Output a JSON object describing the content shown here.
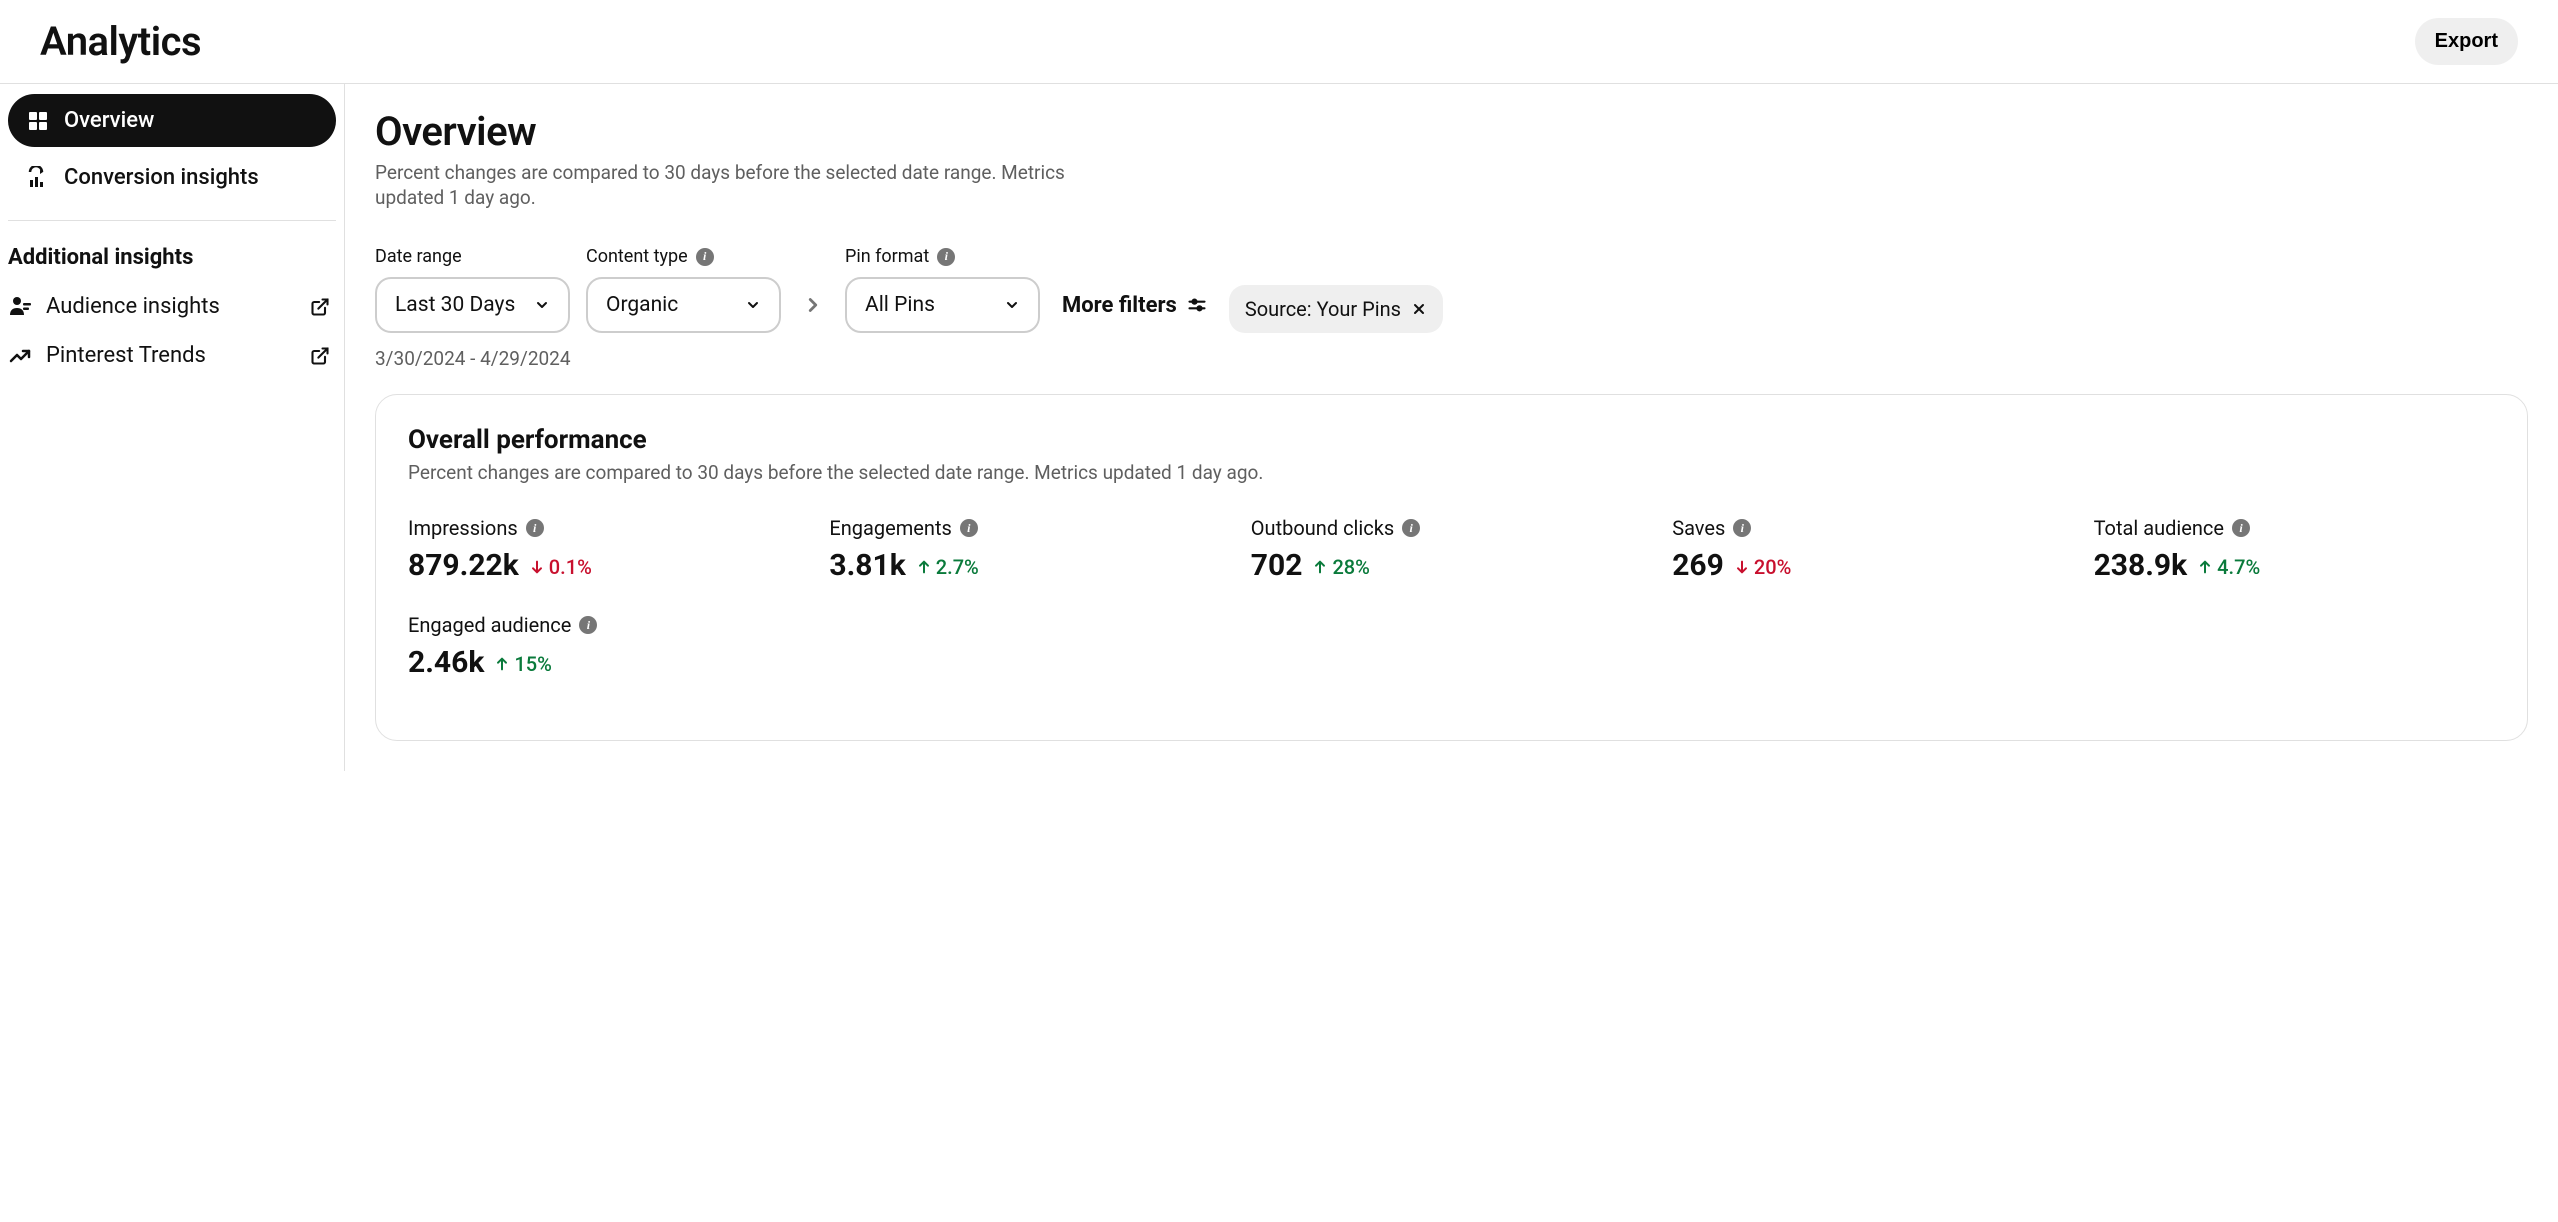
{
  "header": {
    "title": "Analytics",
    "export_label": "Export"
  },
  "sidebar": {
    "items": [
      {
        "label": "Overview"
      },
      {
        "label": "Conversion insights"
      }
    ],
    "section_heading": "Additional insights",
    "external_items": [
      {
        "label": "Audience insights"
      },
      {
        "label": "Pinterest Trends"
      }
    ]
  },
  "main": {
    "title": "Overview",
    "subtext": "Percent changes are compared to 30 days before the selected date range. Metrics updated 1 day ago.",
    "filters": {
      "date_range": {
        "label": "Date range",
        "value": "Last 30 Days"
      },
      "content_type": {
        "label": "Content type",
        "value": "Organic"
      },
      "pin_format": {
        "label": "Pin format",
        "value": "All Pins"
      },
      "more_filters_label": "More filters",
      "chip_label": "Source: Your Pins"
    },
    "date_range_text": "3/30/2024 - 4/29/2024",
    "performance": {
      "title": "Overall performance",
      "subtext": "Percent changes are compared to 30 days before the selected date range. Metrics updated 1 day ago.",
      "metrics": [
        {
          "label": "Impressions",
          "value": "879.22k",
          "change": "0.1%",
          "direction": "down"
        },
        {
          "label": "Engagements",
          "value": "3.81k",
          "change": "2.7%",
          "direction": "up"
        },
        {
          "label": "Outbound clicks",
          "value": "702",
          "change": "28%",
          "direction": "up"
        },
        {
          "label": "Saves",
          "value": "269",
          "change": "20%",
          "direction": "down"
        },
        {
          "label": "Total audience",
          "value": "238.9k",
          "change": "4.7%",
          "direction": "up"
        },
        {
          "label": "Engaged audience",
          "value": "2.46k",
          "change": "15%",
          "direction": "up"
        }
      ]
    }
  }
}
